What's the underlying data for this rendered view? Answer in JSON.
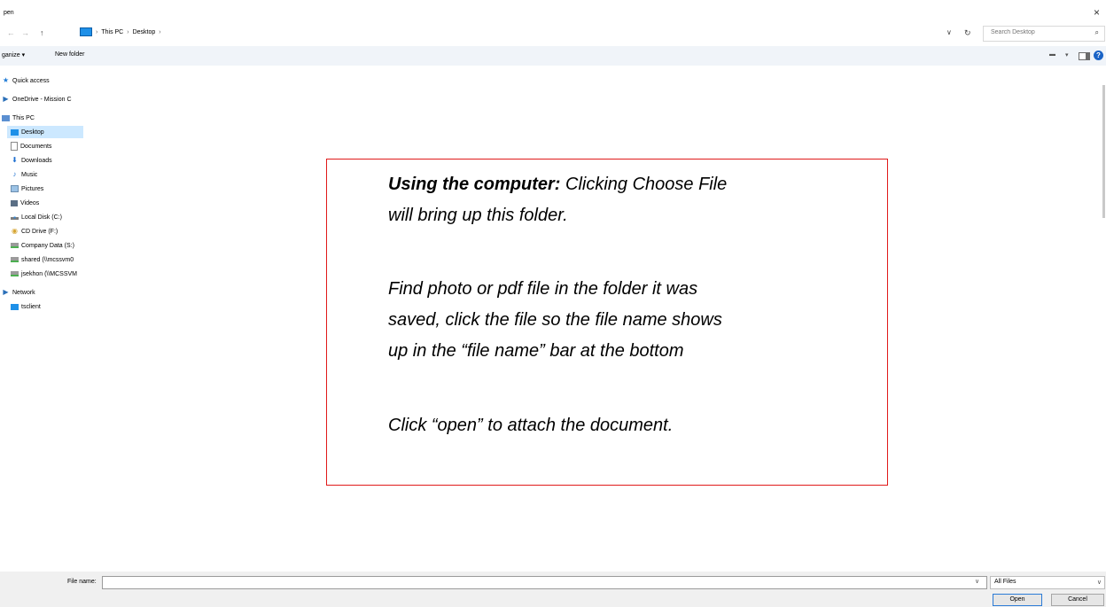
{
  "window": {
    "title": "pen",
    "close": "×"
  },
  "address": {
    "back": "→",
    "forward": "→",
    "up": "↑",
    "crumbs": [
      "This PC",
      "Desktop"
    ],
    "crumb_sep": "›",
    "dropdown": "∨",
    "refresh": "↻",
    "search_placeholder": "Search Desktop",
    "search_icon": "search-icon"
  },
  "toolbar": {
    "organize": "ganize ▾",
    "new_folder": "New folder",
    "view_icon": "▬",
    "view_dropdown": "▾",
    "help": "?"
  },
  "nav": {
    "items": [
      {
        "label": "Quick access",
        "icon": "star-icon"
      },
      {
        "label": "OneDrive - Mission C",
        "icon": "onedrive-icon"
      },
      {
        "label": "This PC",
        "icon": "pc-icon"
      },
      {
        "label": "Desktop",
        "icon": "desktop-icon",
        "selected": true
      },
      {
        "label": "Documents",
        "icon": "documents-icon"
      },
      {
        "label": "Downloads",
        "icon": "downloads-icon"
      },
      {
        "label": "Music",
        "icon": "music-icon"
      },
      {
        "label": "Pictures",
        "icon": "pictures-icon"
      },
      {
        "label": "Videos",
        "icon": "videos-icon"
      },
      {
        "label": "Local Disk (C:)",
        "icon": "local-disk-icon"
      },
      {
        "label": "CD Drive (F:)",
        "icon": "cd-drive-icon"
      },
      {
        "label": "Company Data (S:)",
        "icon": "network-drive-icon"
      },
      {
        "label": "shared (\\\\mcssvm0",
        "icon": "network-drive-icon"
      },
      {
        "label": "jsekhon (\\\\MCSSVM",
        "icon": "network-drive-icon"
      },
      {
        "label": "Network",
        "icon": "network-icon"
      },
      {
        "label": "tsclient",
        "icon": "tsclient-icon"
      }
    ]
  },
  "callout": {
    "lead_bold": "Using the computer:",
    "lead_rest": " Clicking Choose File",
    "line2": "will bring up this folder.",
    "p2_l1": "Find photo or pdf file in the folder it was",
    "p2_l2": "saved, click the file so the file name shows",
    "p2_l3": "up in the “file name” bar at the bottom",
    "p3": "Click “open” to attach the document.",
    "border_color": "#e01a1a"
  },
  "bottom": {
    "file_name_label": "File name:",
    "file_name_value": "",
    "file_dropdown": "∨",
    "filter": "All Files",
    "filter_caret": "∨",
    "open": "Open",
    "cancel": "Cancel"
  }
}
